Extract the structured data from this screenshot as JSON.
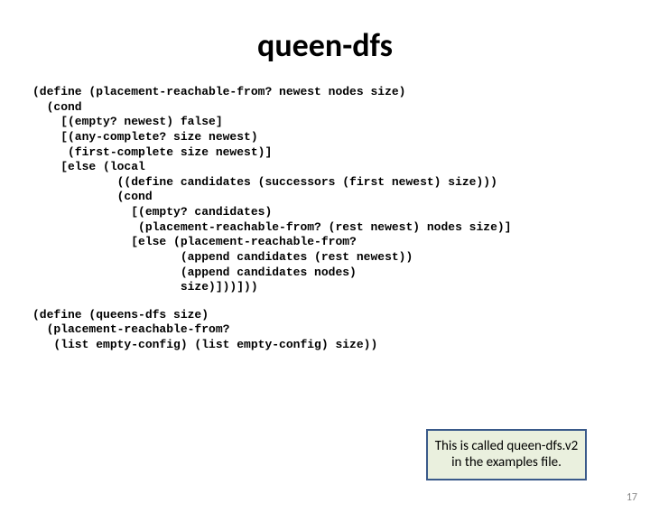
{
  "title": "queen-dfs",
  "code1": "(define (placement-reachable-from? newest nodes size)\n  (cond\n    [(empty? newest) false]\n    [(any-complete? size newest)\n     (first-complete size newest)]\n    [else (local\n            ((define candidates (successors (first newest) size)))\n            (cond\n              [(empty? candidates)\n               (placement-reachable-from? (rest newest) nodes size)]\n              [else (placement-reachable-from?\n                     (append candidates (rest newest))\n                     (append candidates nodes)\n                     size)]))]))",
  "code2": "(define (queens-dfs size)\n  (placement-reachable-from?\n   (list empty-config) (list empty-config) size))",
  "callout": "This is called queen-dfs.v2 in the examples file.",
  "page_number": "17"
}
